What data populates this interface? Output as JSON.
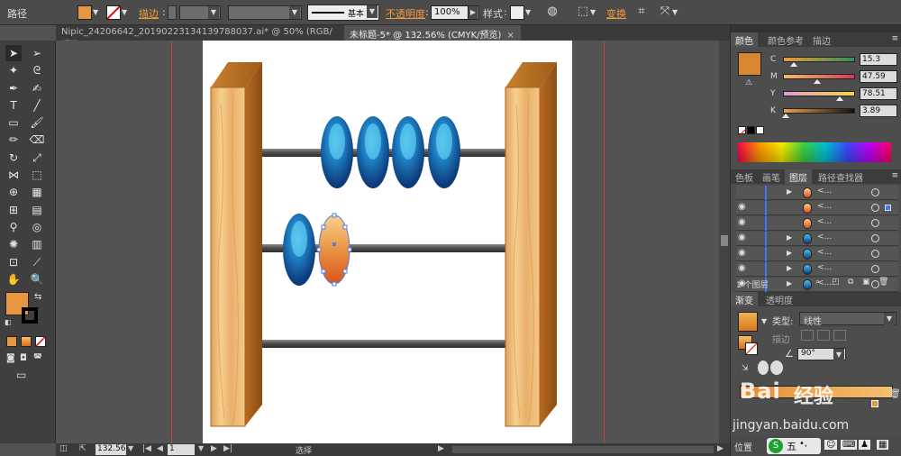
{
  "control_bar": {
    "tool_name": "路径",
    "stroke_label": "描边",
    "stroke_profile_label": "基本",
    "opacity_label": "不透明度",
    "opacity_value": "100%",
    "style_label": "样式",
    "transform_label": "变换",
    "fill_color": "#e89640"
  },
  "tabs": [
    {
      "label": "Nipic_24206642_20190223134139788037.ai* @ 50% (RGB/预览)",
      "close": "×"
    },
    {
      "label": "未标题-5* @ 132.56% (CMYK/预览)",
      "close": "×"
    }
  ],
  "status_bar": {
    "zoom": "132.56",
    "page": "1",
    "mode": "选择"
  },
  "color_panel": {
    "tabs": [
      "颜色",
      "颜色参考",
      "描边"
    ],
    "fill_color": "#d78632",
    "channels": [
      {
        "key": "C",
        "value": "15.3",
        "level": 0.153
      },
      {
        "key": "M",
        "value": "47.59",
        "level": 0.476
      },
      {
        "key": "Y",
        "value": "78.51",
        "level": 0.785
      },
      {
        "key": "K",
        "value": "3.89",
        "level": 0.039
      }
    ]
  },
  "layers_panel": {
    "tabs": [
      "色板",
      "画笔",
      "图层",
      "路径查找器"
    ],
    "rows": [
      {
        "name": "<...",
        "eye": false,
        "twisty": "▶",
        "thumb": "orange"
      },
      {
        "name": "<...",
        "eye": true,
        "twisty": "",
        "thumb": "orange",
        "selected": true
      },
      {
        "name": "<...",
        "eye": true,
        "twisty": "",
        "thumb": "orange"
      },
      {
        "name": "<...",
        "eye": true,
        "twisty": "▶",
        "thumb": "blue"
      },
      {
        "name": "<...",
        "eye": true,
        "twisty": "▶",
        "thumb": "blue"
      },
      {
        "name": "<...",
        "eye": true,
        "twisty": "▶",
        "thumb": "blue"
      },
      {
        "name": "<...",
        "eye": true,
        "twisty": "▶",
        "thumb": "blue"
      }
    ],
    "footer": "1 个图层"
  },
  "gradient_panel": {
    "tabs": [
      "渐变",
      "透明度"
    ],
    "type_label": "类型:",
    "type_value": "线性",
    "stroke_label": "描边",
    "angle": "90°"
  },
  "watermark": {
    "text1": "Bai",
    "text2": "经验",
    "text3": "jingyan.baidu.com"
  },
  "taskbar": {
    "ime": "五",
    "position_label": "位置"
  }
}
